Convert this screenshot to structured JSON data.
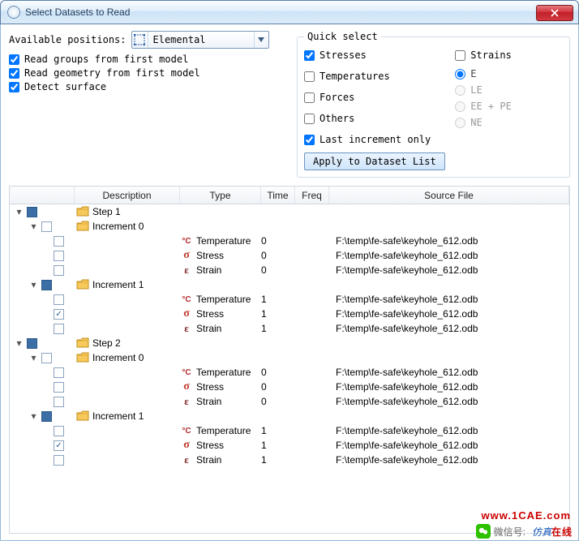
{
  "window": {
    "title": "Select Datasets to Read"
  },
  "left": {
    "available_label": "Available positions:",
    "available_value": "Elemental",
    "read_groups": "Read groups from first model",
    "read_geometry": "Read geometry from first model",
    "detect_surface": "Detect surface"
  },
  "qs": {
    "legend": "Quick select",
    "stresses": "Stresses",
    "temperatures": "Temperatures",
    "forces": "Forces",
    "others": "Others",
    "last_inc": "Last increment only",
    "strains": "Strains",
    "r_e": "E",
    "r_le": "LE",
    "r_eepe": "EE + PE",
    "r_ne": "NE",
    "apply": "Apply to Dataset List"
  },
  "columns": {
    "desc": "Description",
    "type": "Type",
    "time": "Time",
    "freq": "Freq",
    "src": "Source File"
  },
  "src_path": "F:\\temp\\fe-safe\\keyhole_612.odb",
  "labels": {
    "step1": "Step 1",
    "step2": "Step 2",
    "inc0": "Increment 0",
    "inc1": "Increment 1",
    "temperature": "Temperature",
    "stress": "Stress",
    "strain": "Strain"
  },
  "times": {
    "t0": "0",
    "t1": "1"
  },
  "footer": {
    "wechat": "微信号:",
    "wm1": "仿真",
    "wm2": "在线",
    "url": "www.1CAE.com"
  }
}
